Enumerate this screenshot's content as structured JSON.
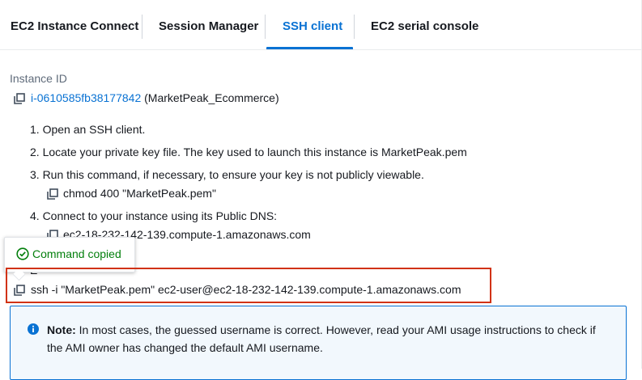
{
  "tabs": [
    {
      "label": "EC2 Instance Connect"
    },
    {
      "label": "Session Manager"
    },
    {
      "label": "SSH client"
    },
    {
      "label": "EC2 serial console"
    }
  ],
  "active_tab": "SSH client",
  "instance": {
    "label": "Instance ID",
    "id": "i-0610585fb38177842",
    "name": "(MarketPeak_Ecommerce)"
  },
  "steps": [
    {
      "text": "1. Open an SSH client."
    },
    {
      "text": "2. Locate your private key file. The key used to launch this instance is MarketPeak.pem"
    },
    {
      "text": "3. Run this command, if necessary, to ensure your key is not publicly viewable."
    },
    {
      "text": "4. Connect to your instance using its Public DNS:"
    }
  ],
  "chmod_command": "chmod 400 \"MarketPeak.pem\"",
  "public_dns": "ec2-18-232-142-139.compute-1.amazonaws.com",
  "example_label": "E",
  "ssh_command": "ssh -i \"MarketPeak.pem\" ec2-user@ec2-18-232-142-139.compute-1.amazonaws.com",
  "tooltip": {
    "text": "Command copied"
  },
  "note": {
    "label": "Note:",
    "text": " In most cases, the guessed username is correct. However, read your AMI usage instructions to check if the AMI owner has changed the default AMI username."
  },
  "colors": {
    "accent": "#0972d3",
    "success": "#037f0c",
    "highlight": "#d13212",
    "note_bg": "#f2f8fd"
  }
}
